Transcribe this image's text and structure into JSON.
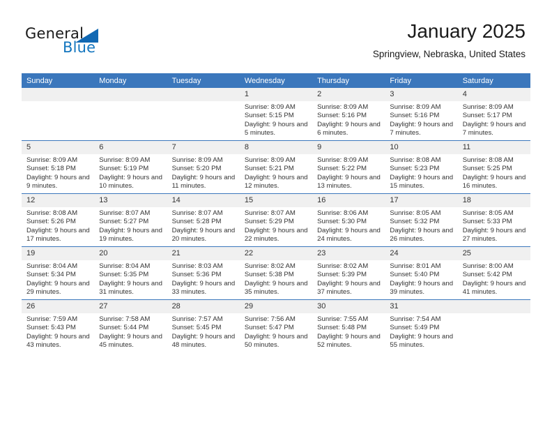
{
  "brand": {
    "name_part1": "General",
    "name_part2": "Blue"
  },
  "header": {
    "title": "January 2025",
    "subtitle": "Springview, Nebraska, United States"
  },
  "colors": {
    "header_blue": "#3b77bc",
    "logo_blue": "#1476bf",
    "daynum_band": "#f0f0f0",
    "text": "#333333"
  },
  "weekdays": [
    "Sunday",
    "Monday",
    "Tuesday",
    "Wednesday",
    "Thursday",
    "Friday",
    "Saturday"
  ],
  "weeks": [
    [
      {
        "day": "",
        "sunrise": "",
        "sunset": "",
        "daylight": "",
        "empty": true
      },
      {
        "day": "",
        "sunrise": "",
        "sunset": "",
        "daylight": "",
        "empty": true
      },
      {
        "day": "",
        "sunrise": "",
        "sunset": "",
        "daylight": "",
        "empty": true
      },
      {
        "day": "1",
        "sunrise": "Sunrise: 8:09 AM",
        "sunset": "Sunset: 5:15 PM",
        "daylight": "Daylight: 9 hours and 5 minutes."
      },
      {
        "day": "2",
        "sunrise": "Sunrise: 8:09 AM",
        "sunset": "Sunset: 5:16 PM",
        "daylight": "Daylight: 9 hours and 6 minutes."
      },
      {
        "day": "3",
        "sunrise": "Sunrise: 8:09 AM",
        "sunset": "Sunset: 5:16 PM",
        "daylight": "Daylight: 9 hours and 7 minutes."
      },
      {
        "day": "4",
        "sunrise": "Sunrise: 8:09 AM",
        "sunset": "Sunset: 5:17 PM",
        "daylight": "Daylight: 9 hours and 7 minutes."
      }
    ],
    [
      {
        "day": "5",
        "sunrise": "Sunrise: 8:09 AM",
        "sunset": "Sunset: 5:18 PM",
        "daylight": "Daylight: 9 hours and 9 minutes."
      },
      {
        "day": "6",
        "sunrise": "Sunrise: 8:09 AM",
        "sunset": "Sunset: 5:19 PM",
        "daylight": "Daylight: 9 hours and 10 minutes."
      },
      {
        "day": "7",
        "sunrise": "Sunrise: 8:09 AM",
        "sunset": "Sunset: 5:20 PM",
        "daylight": "Daylight: 9 hours and 11 minutes."
      },
      {
        "day": "8",
        "sunrise": "Sunrise: 8:09 AM",
        "sunset": "Sunset: 5:21 PM",
        "daylight": "Daylight: 9 hours and 12 minutes."
      },
      {
        "day": "9",
        "sunrise": "Sunrise: 8:09 AM",
        "sunset": "Sunset: 5:22 PM",
        "daylight": "Daylight: 9 hours and 13 minutes."
      },
      {
        "day": "10",
        "sunrise": "Sunrise: 8:08 AM",
        "sunset": "Sunset: 5:23 PM",
        "daylight": "Daylight: 9 hours and 15 minutes."
      },
      {
        "day": "11",
        "sunrise": "Sunrise: 8:08 AM",
        "sunset": "Sunset: 5:25 PM",
        "daylight": "Daylight: 9 hours and 16 minutes."
      }
    ],
    [
      {
        "day": "12",
        "sunrise": "Sunrise: 8:08 AM",
        "sunset": "Sunset: 5:26 PM",
        "daylight": "Daylight: 9 hours and 17 minutes."
      },
      {
        "day": "13",
        "sunrise": "Sunrise: 8:07 AM",
        "sunset": "Sunset: 5:27 PM",
        "daylight": "Daylight: 9 hours and 19 minutes."
      },
      {
        "day": "14",
        "sunrise": "Sunrise: 8:07 AM",
        "sunset": "Sunset: 5:28 PM",
        "daylight": "Daylight: 9 hours and 20 minutes."
      },
      {
        "day": "15",
        "sunrise": "Sunrise: 8:07 AM",
        "sunset": "Sunset: 5:29 PM",
        "daylight": "Daylight: 9 hours and 22 minutes."
      },
      {
        "day": "16",
        "sunrise": "Sunrise: 8:06 AM",
        "sunset": "Sunset: 5:30 PM",
        "daylight": "Daylight: 9 hours and 24 minutes."
      },
      {
        "day": "17",
        "sunrise": "Sunrise: 8:05 AM",
        "sunset": "Sunset: 5:32 PM",
        "daylight": "Daylight: 9 hours and 26 minutes."
      },
      {
        "day": "18",
        "sunrise": "Sunrise: 8:05 AM",
        "sunset": "Sunset: 5:33 PM",
        "daylight": "Daylight: 9 hours and 27 minutes."
      }
    ],
    [
      {
        "day": "19",
        "sunrise": "Sunrise: 8:04 AM",
        "sunset": "Sunset: 5:34 PM",
        "daylight": "Daylight: 9 hours and 29 minutes."
      },
      {
        "day": "20",
        "sunrise": "Sunrise: 8:04 AM",
        "sunset": "Sunset: 5:35 PM",
        "daylight": "Daylight: 9 hours and 31 minutes."
      },
      {
        "day": "21",
        "sunrise": "Sunrise: 8:03 AM",
        "sunset": "Sunset: 5:36 PM",
        "daylight": "Daylight: 9 hours and 33 minutes."
      },
      {
        "day": "22",
        "sunrise": "Sunrise: 8:02 AM",
        "sunset": "Sunset: 5:38 PM",
        "daylight": "Daylight: 9 hours and 35 minutes."
      },
      {
        "day": "23",
        "sunrise": "Sunrise: 8:02 AM",
        "sunset": "Sunset: 5:39 PM",
        "daylight": "Daylight: 9 hours and 37 minutes."
      },
      {
        "day": "24",
        "sunrise": "Sunrise: 8:01 AM",
        "sunset": "Sunset: 5:40 PM",
        "daylight": "Daylight: 9 hours and 39 minutes."
      },
      {
        "day": "25",
        "sunrise": "Sunrise: 8:00 AM",
        "sunset": "Sunset: 5:42 PM",
        "daylight": "Daylight: 9 hours and 41 minutes."
      }
    ],
    [
      {
        "day": "26",
        "sunrise": "Sunrise: 7:59 AM",
        "sunset": "Sunset: 5:43 PM",
        "daylight": "Daylight: 9 hours and 43 minutes."
      },
      {
        "day": "27",
        "sunrise": "Sunrise: 7:58 AM",
        "sunset": "Sunset: 5:44 PM",
        "daylight": "Daylight: 9 hours and 45 minutes."
      },
      {
        "day": "28",
        "sunrise": "Sunrise: 7:57 AM",
        "sunset": "Sunset: 5:45 PM",
        "daylight": "Daylight: 9 hours and 48 minutes."
      },
      {
        "day": "29",
        "sunrise": "Sunrise: 7:56 AM",
        "sunset": "Sunset: 5:47 PM",
        "daylight": "Daylight: 9 hours and 50 minutes."
      },
      {
        "day": "30",
        "sunrise": "Sunrise: 7:55 AM",
        "sunset": "Sunset: 5:48 PM",
        "daylight": "Daylight: 9 hours and 52 minutes."
      },
      {
        "day": "31",
        "sunrise": "Sunrise: 7:54 AM",
        "sunset": "Sunset: 5:49 PM",
        "daylight": "Daylight: 9 hours and 55 minutes."
      },
      {
        "day": "",
        "sunrise": "",
        "sunset": "",
        "daylight": "",
        "empty": true
      }
    ]
  ]
}
